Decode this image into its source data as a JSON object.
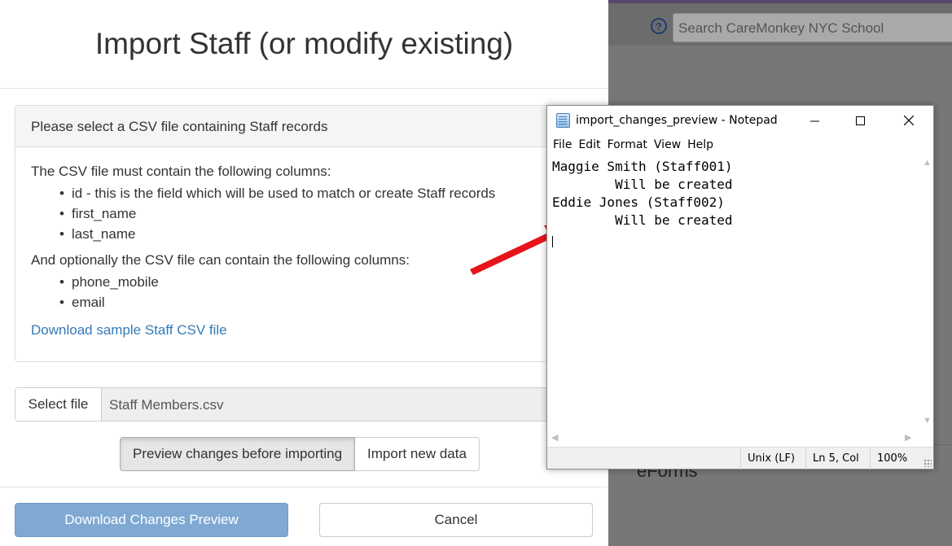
{
  "background_app": {
    "search_placeholder": "Search CareMonkey NYC School",
    "help_icon": "?",
    "footer_fragment": "eForms"
  },
  "modal": {
    "title": "Import Staff (or modify existing)",
    "panel": {
      "heading": "Please select a CSV file containing Staff records",
      "required_intro": "The CSV file must contain the following columns:",
      "required_columns": [
        "id - this is the field which will be used to match or create Staff records",
        "first_name",
        "last_name"
      ],
      "optional_intro": "And optionally the CSV file can contain the following columns:",
      "optional_columns": [
        "phone_mobile",
        "email"
      ],
      "download_sample_link": "Download sample Staff CSV file"
    },
    "file_picker": {
      "button_label": "Select file",
      "file_name": "Staff Members.csv"
    },
    "mode_options": {
      "preview_label": "Preview changes before importing",
      "import_label": "Import new data",
      "selected": "preview"
    },
    "actions": {
      "download_preview_label": "Download Changes Preview",
      "cancel_label": "Cancel"
    }
  },
  "notepad": {
    "title": "import_changes_preview - Notepad",
    "menu": [
      "File",
      "Edit",
      "Format",
      "View",
      "Help"
    ],
    "content_lines": [
      "Maggie Smith (Staff001)",
      "        Will be created",
      "Eddie Jones (Staff002)",
      "        Will be created"
    ],
    "status": {
      "line_endings": "Unix (LF)",
      "position": "Ln 5, Col",
      "zoom": "100%"
    }
  },
  "colors": {
    "primary_button": "#7fa9d3",
    "link": "#337ab7",
    "arrow": "#e8141b"
  }
}
